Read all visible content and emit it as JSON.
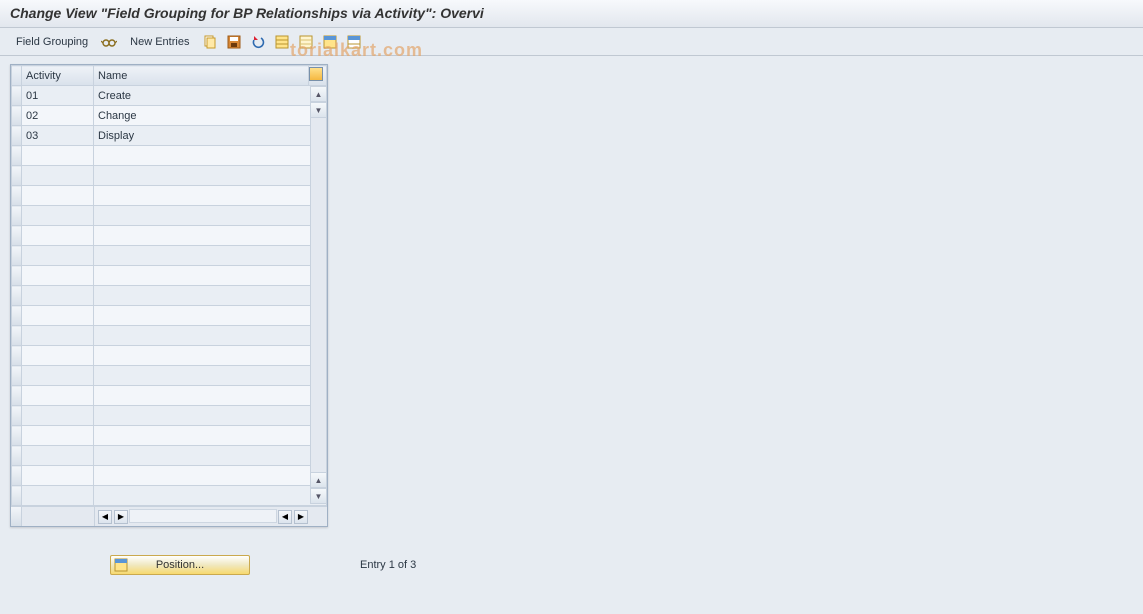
{
  "title": "Change View \"Field Grouping for BP Relationships via Activity\": Overvi",
  "toolbar": {
    "field_grouping_label": "Field Grouping",
    "new_entries_label": "New Entries"
  },
  "watermark": "torialkart.com",
  "table": {
    "headers": {
      "activity": "Activity",
      "name": "Name"
    },
    "rows": [
      {
        "activity": "01",
        "name": "Create"
      },
      {
        "activity": "02",
        "name": "Change"
      },
      {
        "activity": "03",
        "name": "Display"
      },
      {
        "activity": "",
        "name": ""
      },
      {
        "activity": "",
        "name": ""
      },
      {
        "activity": "",
        "name": ""
      },
      {
        "activity": "",
        "name": ""
      },
      {
        "activity": "",
        "name": ""
      },
      {
        "activity": "",
        "name": ""
      },
      {
        "activity": "",
        "name": ""
      },
      {
        "activity": "",
        "name": ""
      },
      {
        "activity": "",
        "name": ""
      },
      {
        "activity": "",
        "name": ""
      },
      {
        "activity": "",
        "name": ""
      },
      {
        "activity": "",
        "name": ""
      },
      {
        "activity": "",
        "name": ""
      },
      {
        "activity": "",
        "name": ""
      },
      {
        "activity": "",
        "name": ""
      },
      {
        "activity": "",
        "name": ""
      },
      {
        "activity": "",
        "name": ""
      },
      {
        "activity": "",
        "name": ""
      }
    ]
  },
  "footer": {
    "position_label": "Position...",
    "entry_label": "Entry 1 of 3"
  }
}
